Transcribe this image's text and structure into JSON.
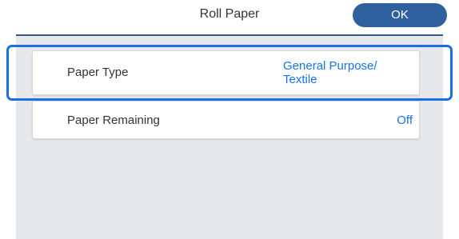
{
  "header": {
    "title": "Roll Paper",
    "ok_label": "OK"
  },
  "settings": [
    {
      "label": "Paper Type",
      "value_line1": "General Purpose/",
      "value_line2": "Textile"
    },
    {
      "label": "Paper Remaining",
      "value": "Off"
    }
  ],
  "colors": {
    "accent": "#1a73e8",
    "ok_button": "#2f5f9e",
    "focus": "#1a6fe6",
    "panel": "#e6e8ec"
  }
}
